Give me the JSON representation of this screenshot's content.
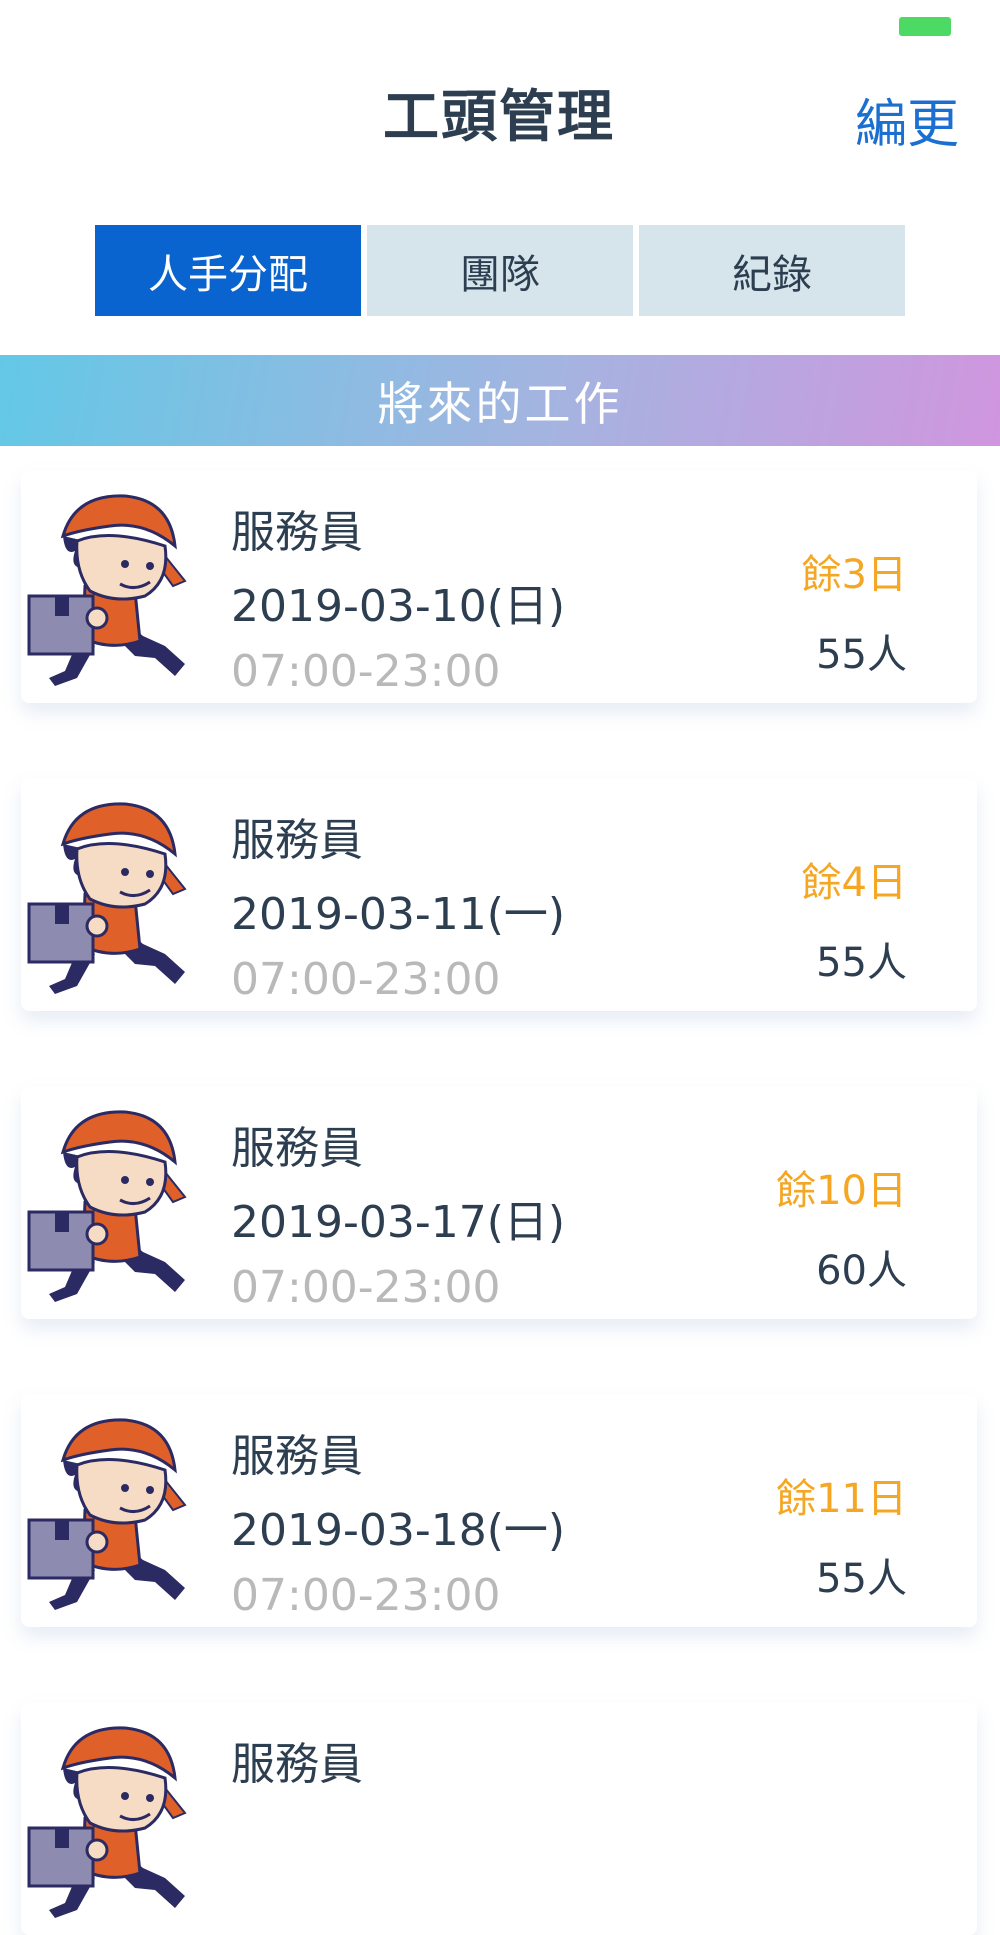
{
  "header": {
    "title": "工頭管理",
    "edit_label": "編更"
  },
  "tabs": [
    {
      "label": "人手分配",
      "active": true
    },
    {
      "label": "團隊",
      "active": false
    },
    {
      "label": "紀錄",
      "active": false
    }
  ],
  "section": {
    "title": "將來的工作"
  },
  "jobs": [
    {
      "title": "服務員",
      "date": "2019-03-10(日)",
      "time": "07:00-23:00",
      "days_left": "餘3日",
      "headcount": "55人"
    },
    {
      "title": "服務員",
      "date": "2019-03-11(一)",
      "time": "07:00-23:00",
      "days_left": "餘4日",
      "headcount": "55人"
    },
    {
      "title": "服務員",
      "date": "2019-03-17(日)",
      "time": "07:00-23:00",
      "days_left": "餘10日",
      "headcount": "60人"
    },
    {
      "title": "服務員",
      "date": "2019-03-18(一)",
      "time": "07:00-23:00",
      "days_left": "餘11日",
      "headcount": "55人"
    },
    {
      "title": "服務員"
    }
  ],
  "colors": {
    "accent": "#0a64d0",
    "tab_inactive": "#d6e4ec",
    "days_left": "#f5a623",
    "battery": "#4cd964"
  },
  "icons": {
    "avatar": "delivery-worker-mascot-icon"
  }
}
